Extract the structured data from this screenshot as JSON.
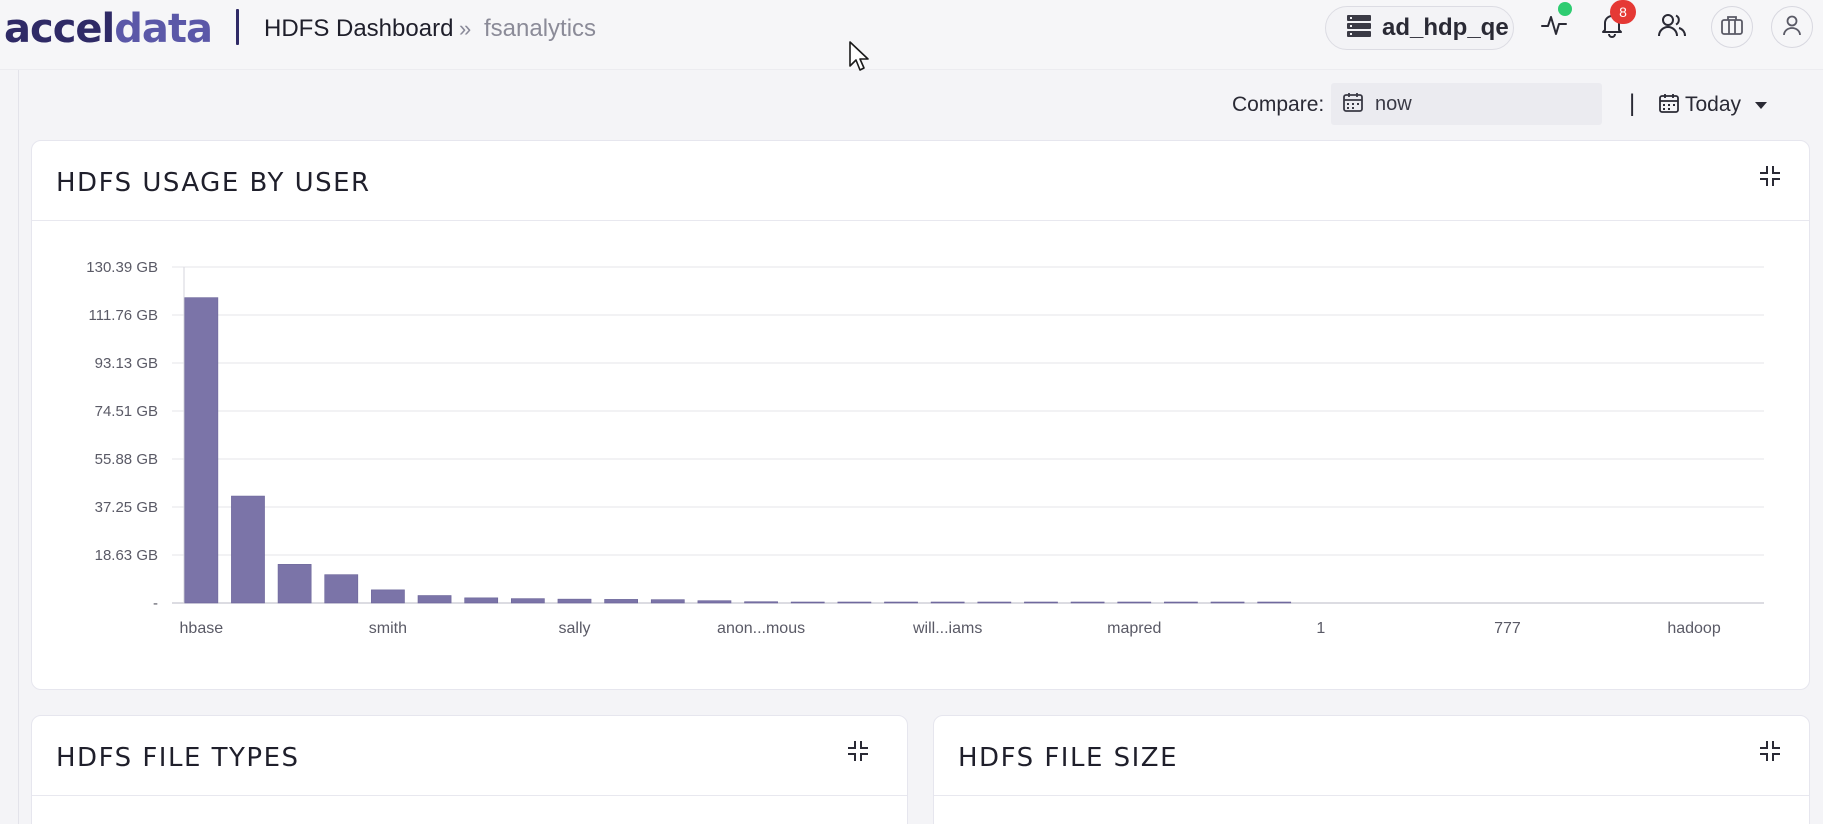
{
  "header": {
    "logo": {
      "part1": "acce",
      "part2": "l",
      "part3": "data"
    },
    "title": "HDFS Dashboard",
    "separator": "»",
    "subtitle": "fsanalytics",
    "cluster": "ad_hdp_qe",
    "notification_count": "8",
    "icons": [
      "cluster-icon",
      "activity-icon",
      "bell-icon",
      "users-icon",
      "briefcase-icon",
      "user-icon"
    ],
    "status_color": "#2ecc71"
  },
  "compare": {
    "label": "Compare:",
    "value": "now",
    "separator": "|",
    "range": "Today"
  },
  "usage_card": {
    "title": "HDFS USAGE BY USER"
  },
  "filetypes_card": {
    "title": "HDFS FILE TYPES"
  },
  "filesize_card": {
    "title": "HDFS FILE SIZE"
  },
  "colors": {
    "bar": "#7b74a8",
    "brand": "#2f2a66"
  },
  "chart_data": {
    "type": "bar",
    "title": "",
    "xlabel": "",
    "ylabel": "",
    "y_unit": "GB",
    "y_ticks": [
      "-",
      "18.63 GB",
      "37.25 GB",
      "55.88 GB",
      "74.51 GB",
      "93.13 GB",
      "111.76 GB",
      "130.39 GB"
    ],
    "ylim": [
      0,
      130.39
    ],
    "x_tick_labels": [
      "hbase",
      "smith",
      "sally",
      "anon...mous",
      "will...iams",
      "mapred",
      "1",
      "777",
      "hadoop"
    ],
    "values": [
      118.5,
      41.5,
      15.0,
      11.0,
      5.1,
      2.9,
      2.0,
      1.7,
      1.5,
      1.4,
      1.3,
      0.9,
      0.5,
      0.3,
      0.3,
      0.3,
      0.3,
      0.3,
      0.3,
      0.3,
      0.3,
      0.3,
      0.3,
      0.3,
      0,
      0,
      0,
      0,
      0,
      0,
      0,
      0,
      0,
      0
    ],
    "grid": true,
    "legend": "none"
  }
}
